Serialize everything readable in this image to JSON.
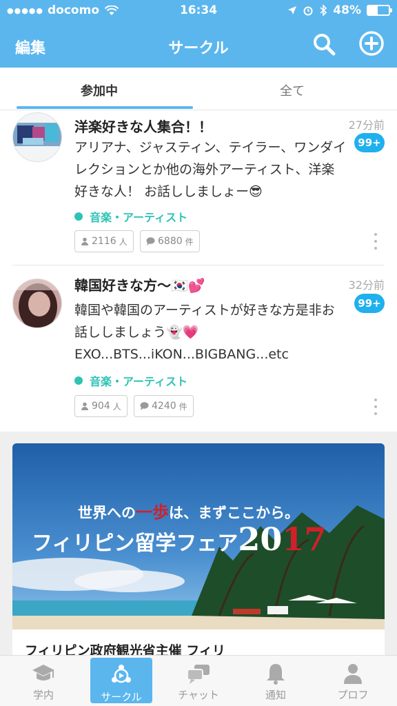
{
  "status_bar": {
    "carrier": "docomo",
    "time": "16:34",
    "battery": "48%",
    "battery_level": 0.48
  },
  "nav": {
    "edit_label": "編集",
    "title": "サークル",
    "search_icon": "search-icon",
    "add_icon": "plus-circle-icon"
  },
  "tabs": [
    {
      "label": "参加中",
      "active": true
    },
    {
      "label": "全て",
      "active": false
    }
  ],
  "circles": [
    {
      "title": "洋楽好きな人集合！！",
      "time": "27分前",
      "badge": "99+",
      "description": "アリアナ、ジャスティン、テイラー、ワンダイレクションとか他の海外アーティスト、洋楽好きな人！ お話ししましょー😎",
      "category": "音楽・アーティスト",
      "members": "2116",
      "members_unit": "人",
      "posts": "6880",
      "posts_unit": "件"
    },
    {
      "title": "韓国好きな方〜🇰🇷💕",
      "time": "32分前",
      "badge": "99+",
      "description": "韓国や韓国のアーティストが好きな方是非お話ししましょう👻💗 EXO...BTS...iKON...BIGBANG...etc",
      "category": "音楽・アーティスト",
      "members": "904",
      "members_unit": "人",
      "posts": "4240",
      "posts_unit": "件"
    }
  ],
  "ad": {
    "headline_pre": "世界への",
    "headline_accent": "一歩",
    "headline_post": "は、まずここから。",
    "title_main": "フィリピン留学フェア",
    "year_a": "20",
    "year_b": "17",
    "caption": "フィリピン政府観光省主催 フィリ"
  },
  "tabbar": [
    {
      "label": "学内",
      "icon": "graduation-cap-icon",
      "active": false
    },
    {
      "label": "サークル",
      "icon": "circle-network-icon",
      "active": true
    },
    {
      "label": "チャット",
      "icon": "chat-bubbles-icon",
      "active": false
    },
    {
      "label": "通知",
      "icon": "bell-icon",
      "active": false
    },
    {
      "label": "プロフ",
      "icon": "person-icon",
      "active": false
    }
  ],
  "colors": {
    "brand": "#5bb6ee",
    "badge": "#1fb0ee",
    "category": "#2ec3b5"
  }
}
